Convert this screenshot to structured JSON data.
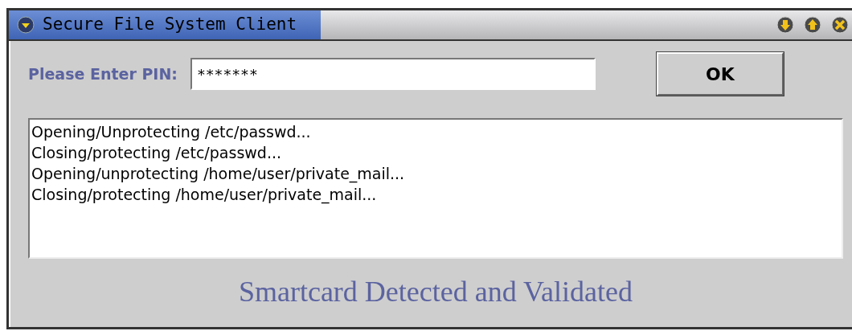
{
  "window": {
    "title": "Secure File System Client"
  },
  "pin": {
    "label": "Please Enter PIN:",
    "value": "*******"
  },
  "ok_button": "OK",
  "log_lines": [
    "Opening/Unprotecting /etc/passwd...",
    "Closing/protecting /etc/passwd...",
    "Opening/unprotecting /home/user/private_mail...",
    "Closing/protecting /home/user/private_mail..."
  ],
  "status": "Smartcard Detected and Validated"
}
